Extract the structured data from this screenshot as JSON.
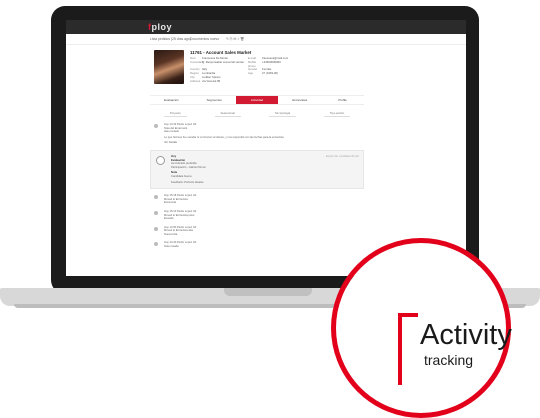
{
  "app": {
    "logo_prefix": "f",
    "logo_rest": "ploy",
    "sub_left": "Lista pedidos (25 días ago)",
    "sub_mid": "Documentos nuevo"
  },
  "profile": {
    "title": "11761 - Account Sales Market",
    "fields": [
      {
        "k": "Nom",
        "v": "Francesca De Monte",
        "k2": "E-mail",
        "v2": "francesca@mail.com"
      },
      {
        "k": "Consultant",
        "v": "Q: Responsable comercial ventas",
        "k2": "Mobile phone",
        "v2": "+34600000000"
      },
      {
        "k": "Country",
        "v": "Italy",
        "k2": "Gender",
        "v2": "Female"
      },
      {
        "k": "Region",
        "v": "Lombardia",
        "k2": "Age",
        "v2": "27 (1993-06)"
      },
      {
        "k": "City",
        "v": "Ludiker Spinos",
        "k2": "",
        "v2": ""
      },
      {
        "k": "Address",
        "v": "via Venezia 86",
        "k2": "",
        "v2": ""
      }
    ]
  },
  "tabs": [
    {
      "label": "Evaluación"
    },
    {
      "label": "Segmentos"
    },
    {
      "label": "Actividad"
    },
    {
      "label": "Entrevistas"
    },
    {
      "label": "Profile"
    }
  ],
  "filters": [
    "Proyecto",
    "Seleccionar",
    "Sin tipología",
    "Tipo acción"
  ],
  "feed": [
    {
      "line1": "Hoy 14:32 Pedro Lopez Gil",
      "line2": "Nota del Email sent",
      "line3": "Has enviado",
      "body": "Lo que hicimos fue mandar el currículum al cliente, y nos respondió con las fechas para la entrevista.",
      "footer": "Ver Detalle"
    },
    {
      "title": "Hoy",
      "sub": "Evaluación",
      "by": "Ha indicado preferida",
      "by2": "Participación - Gabriel Simon",
      "note": "Nota",
      "note2": "Candidata buena",
      "extra": "Feedback: Perfecto ideales",
      "right": "Enviar  Ver candidato  Borrar"
    },
    {
      "line1": "Hoy 15:18 Pedro Lopez Gil",
      "line2": "Moved to Entrevista",
      "line3": "Entrevista"
    },
    {
      "line1": "Hoy 15:10 Pedro Lopez Gil",
      "line2": "Moved to Entrevista paso",
      "line3": "Enviado"
    },
    {
      "line1": "Hoy 14:50 Pedro Lopez Gil",
      "line2": "Moved to Entrevista alta",
      "line3": "Nueva lista"
    },
    {
      "line1": "Hoy 14:30 Pedro Lopez Gil",
      "line2": "Nota creada",
      "line3": ""
    }
  ],
  "badge": {
    "title": "Activity",
    "sub": "tracking",
    "accent": "#e2001a"
  }
}
